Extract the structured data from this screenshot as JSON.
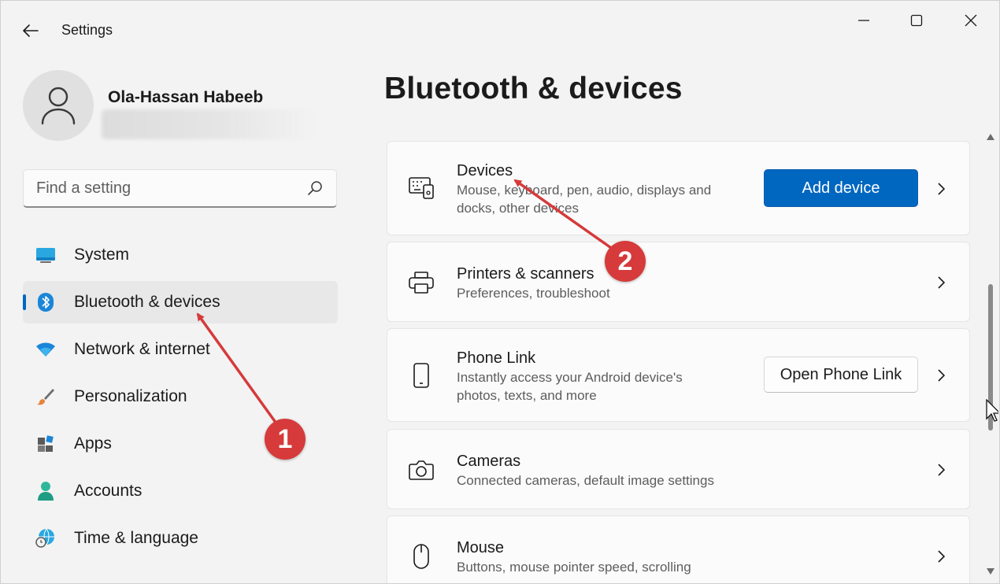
{
  "window": {
    "title": "Settings",
    "controls": {
      "minimize": "minimize",
      "maximize": "maximize",
      "close": "close"
    }
  },
  "profile": {
    "name": "Ola-Hassan Habeeb"
  },
  "search": {
    "placeholder": "Find a setting"
  },
  "nav": {
    "items": [
      {
        "label": "System",
        "icon": "monitor-icon"
      },
      {
        "label": "Bluetooth & devices",
        "icon": "bluetooth-icon",
        "selected": true
      },
      {
        "label": "Network & internet",
        "icon": "wifi-icon"
      },
      {
        "label": "Personalization",
        "icon": "brush-icon"
      },
      {
        "label": "Apps",
        "icon": "apps-icon"
      },
      {
        "label": "Accounts",
        "icon": "person-icon"
      },
      {
        "label": "Time & language",
        "icon": "globe-clock-icon"
      }
    ]
  },
  "main": {
    "title": "Bluetooth & devices",
    "cards": [
      {
        "title": "Devices",
        "sub1": "Mouse, keyboard, pen, audio, displays and",
        "sub2": "docks, other devices",
        "button": "Add device",
        "icon": "keyboard-device-icon"
      },
      {
        "title": "Printers & scanners",
        "sub1": "Preferences, troubleshoot",
        "icon": "printer-icon"
      },
      {
        "title": "Phone Link",
        "sub1": "Instantly access your Android device's",
        "sub2": "photos, texts, and more",
        "button": "Open Phone Link",
        "icon": "phone-icon"
      },
      {
        "title": "Cameras",
        "sub1": "Connected cameras, default image settings",
        "icon": "camera-icon"
      },
      {
        "title": "Mouse",
        "sub1": "Buttons, mouse pointer speed, scrolling",
        "icon": "mouse-icon"
      }
    ]
  },
  "annotations": {
    "badge1": "1",
    "badge2": "2"
  },
  "colors": {
    "accent": "#0067c0",
    "annotation": "#d63a3a",
    "background": "#f3f3f3",
    "card": "#fbfbfb"
  }
}
